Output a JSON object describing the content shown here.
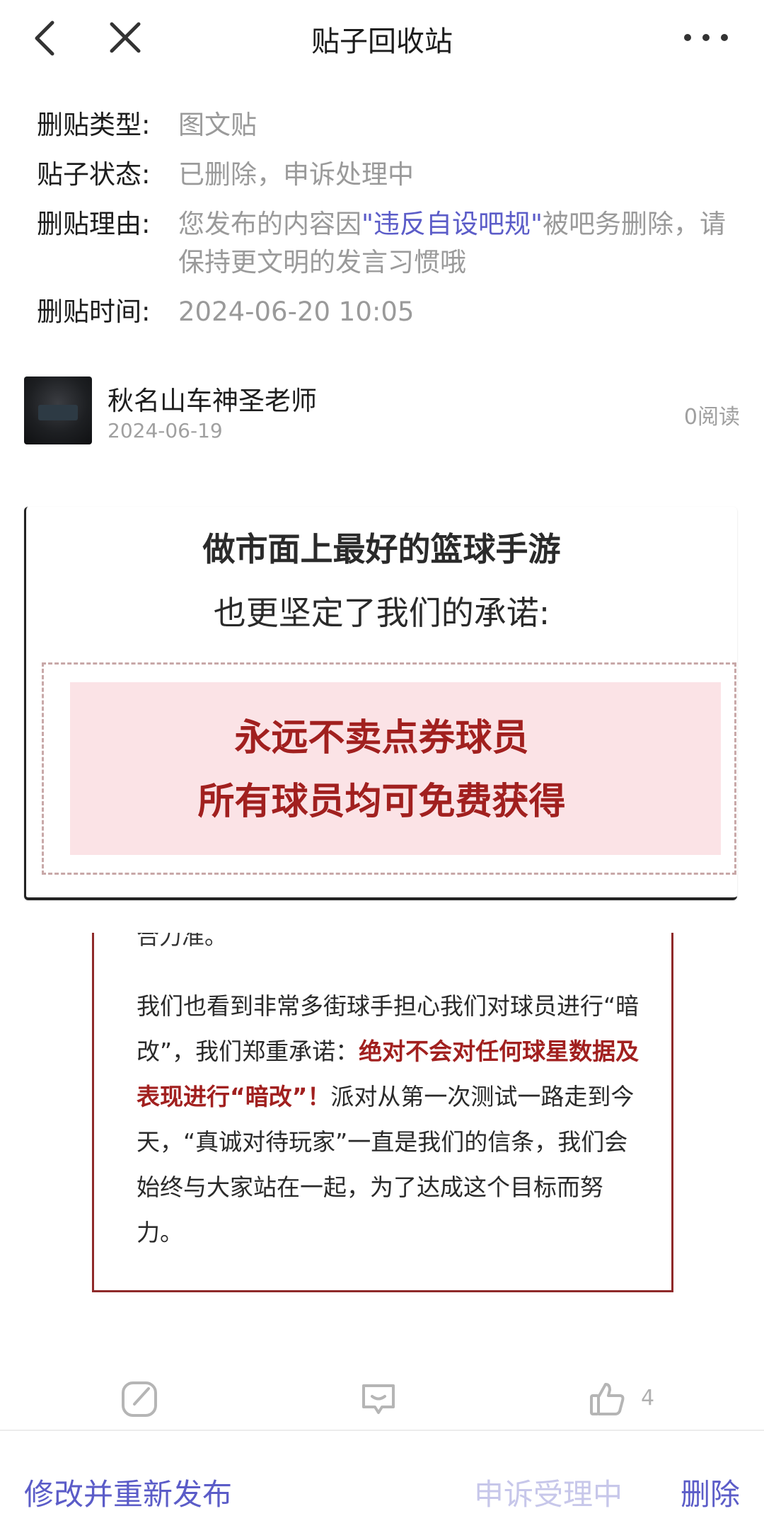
{
  "header": {
    "title": "贴子回收站",
    "back_icon": "chevron-left-icon",
    "close_icon": "close-icon",
    "more_icon": "more-horizontal-icon"
  },
  "info": {
    "type_label": "删贴类型:",
    "type_value": "图文贴",
    "status_label": "贴子状态:",
    "status_value": "已删除，申诉处理中",
    "reason_label": "删贴理由:",
    "reason_prefix": "您发布的内容因",
    "reason_link": "\"违反自设吧规\"",
    "reason_suffix": "被吧务删除，请保持更文明的发言习惯哦",
    "time_label": "删贴时间:",
    "time_value": "2024-06-20 10:05"
  },
  "author": {
    "name": "秋名山车神圣老师",
    "date": "2024-06-19",
    "reads": "0阅读"
  },
  "post": {
    "slide": {
      "line1": "做市面上最好的篮球手游",
      "line2": "也更坚定了我们的承诺:",
      "promise1": "永远不卖点券球员",
      "promise2": "所有球员均可免费获得"
    },
    "article": {
      "clipped_top": "合力准。",
      "p_start": "我们也看到非常多街球手担心我们对球员进行“暗改”，我们郑重承诺：",
      "p_highlight": "绝对不会对任何球星数据及表现进行“暗改”！",
      "p_end": "派对从第一次测试一路走到今天，“真诚对待玩家”一直是我们的信条，我们会始终与大家站在一起，为了达成这个目标而努力。"
    }
  },
  "actions": {
    "edit_icon": "edit-icon",
    "comment_icon": "comment-icon",
    "like_icon": "thumbs-up-icon",
    "like_count": "4"
  },
  "bottom": {
    "republish": "修改并重新发布",
    "appeal": "申诉受理中",
    "delete": "删除"
  },
  "colors": {
    "accent": "#5b5cc8",
    "accent_disabled": "#c7c7ea",
    "highlight_red": "#a1201f"
  }
}
